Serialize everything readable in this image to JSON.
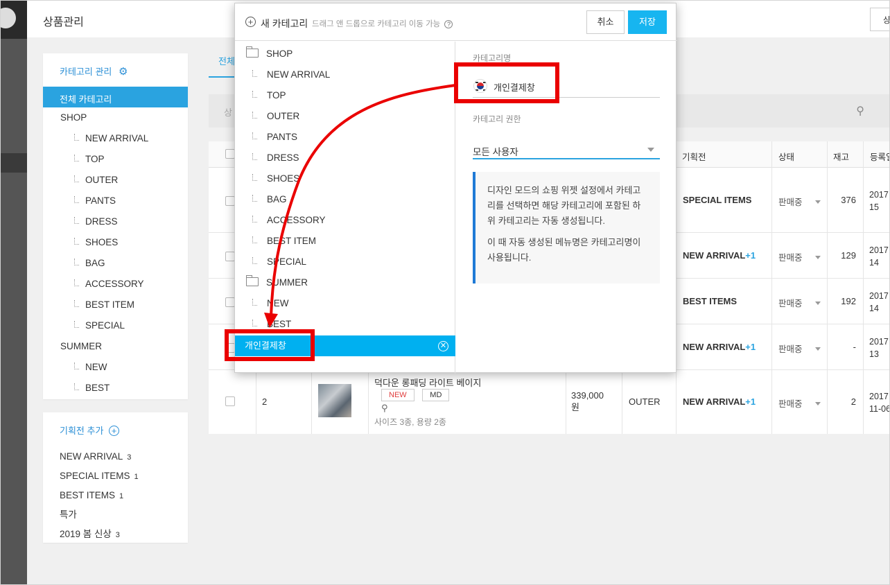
{
  "topbar": {
    "title": "상품관리",
    "right_button": "상"
  },
  "sidebar": {
    "category_header": "카테고리 관리",
    "all_categories": "전체 카테고리",
    "tree": [
      {
        "label": "SHOP",
        "level": 0
      },
      {
        "label": "NEW ARRIVAL",
        "level": 1
      },
      {
        "label": "TOP",
        "level": 1
      },
      {
        "label": "OUTER",
        "level": 1
      },
      {
        "label": "PANTS",
        "level": 1
      },
      {
        "label": "DRESS",
        "level": 1
      },
      {
        "label": "SHOES",
        "level": 1
      },
      {
        "label": "BAG",
        "level": 1
      },
      {
        "label": "ACCESSORY",
        "level": 1
      },
      {
        "label": "BEST ITEM",
        "level": 1
      },
      {
        "label": "SPECIAL",
        "level": 1
      },
      {
        "label": "SUMMER",
        "level": 0
      },
      {
        "label": "NEW",
        "level": 1
      },
      {
        "label": "BEST",
        "level": 1
      }
    ],
    "exhibition_header": "기획전 추가",
    "exhibitions": [
      {
        "label": "NEW ARRIVAL",
        "count": "3"
      },
      {
        "label": "SPECIAL ITEMS",
        "count": "1"
      },
      {
        "label": "BEST ITEMS",
        "count": "1"
      },
      {
        "label": "특가",
        "count": ""
      },
      {
        "label": "2019 봄 신상",
        "count": "3"
      }
    ]
  },
  "main": {
    "tab_label": "전체",
    "search_placeholder": "상",
    "columns": [
      "기획전",
      "상태",
      "재고",
      "등록일"
    ],
    "rows": [
      {
        "exhibition": "SPECIAL ITEMS",
        "plus": "",
        "status": "판매중",
        "stock": "376",
        "reg1": "2017",
        "reg2": "15"
      },
      {
        "exhibition": "NEW ARRIVAL",
        "plus": "+1",
        "status": "판매중",
        "stock": "129",
        "reg1": "2017",
        "reg2": "14"
      },
      {
        "exhibition": "BEST ITEMS",
        "plus": "",
        "status": "판매중",
        "stock": "192",
        "reg1": "2017",
        "reg2": "14"
      },
      {
        "exhibition": "NEW ARRIVAL",
        "plus": "+1",
        "status": "판매중",
        "stock": "-",
        "reg1": "2017",
        "reg2": "13"
      },
      {
        "exhibition": "NEW ARRIVAL",
        "plus": "+1",
        "status": "판매중",
        "stock": "2",
        "reg1": "2017",
        "reg2": "11-06"
      }
    ],
    "last_row": {
      "index": "2",
      "product_name": "덕다운 롱패딩 라이트 베이지",
      "badge_new": "NEW",
      "badge_md": "MD",
      "options": "사이즈 3종, 용량 2종",
      "price": "339,000\n원",
      "category": "OUTER"
    }
  },
  "modal": {
    "add_label": "새 카테고리",
    "hint": "드래그 앤 드롭으로 카테고리 이동 가능",
    "cancel_label": "취소",
    "save_label": "저장",
    "tree": [
      {
        "label": "SHOP",
        "level": 0
      },
      {
        "label": "NEW ARRIVAL",
        "level": 1
      },
      {
        "label": "TOP",
        "level": 1
      },
      {
        "label": "OUTER",
        "level": 1
      },
      {
        "label": "PANTS",
        "level": 1
      },
      {
        "label": "DRESS",
        "level": 1
      },
      {
        "label": "SHOES",
        "level": 1
      },
      {
        "label": "BAG",
        "level": 1
      },
      {
        "label": "ACCESSORY",
        "level": 1
      },
      {
        "label": "BEST ITEM",
        "level": 1
      },
      {
        "label": "SPECIAL",
        "level": 1
      },
      {
        "label": "SUMMER",
        "level": 0
      },
      {
        "label": "NEW",
        "level": 1
      },
      {
        "label": "BEST",
        "level": 1
      }
    ],
    "selected_item": "개인결제창",
    "form": {
      "name_label": "카테고리명",
      "name_value": "개인결제창",
      "permission_label": "카테고리 권한",
      "permission_value": "모든 사용자",
      "info_p1": "디자인 모드의 쇼핑 위젯 설정에서 카테고리를 선택하면 해당 카테고리에 포함된 하위 카테고리는 자동 생성됩니다.",
      "info_p2": "이 때 자동 생성된 메뉴명은 카테고리명이 사용됩니다."
    }
  },
  "colors": {
    "accent": "#17b5f0",
    "highlight": "#ea0000",
    "link": "#2b8fd6"
  }
}
